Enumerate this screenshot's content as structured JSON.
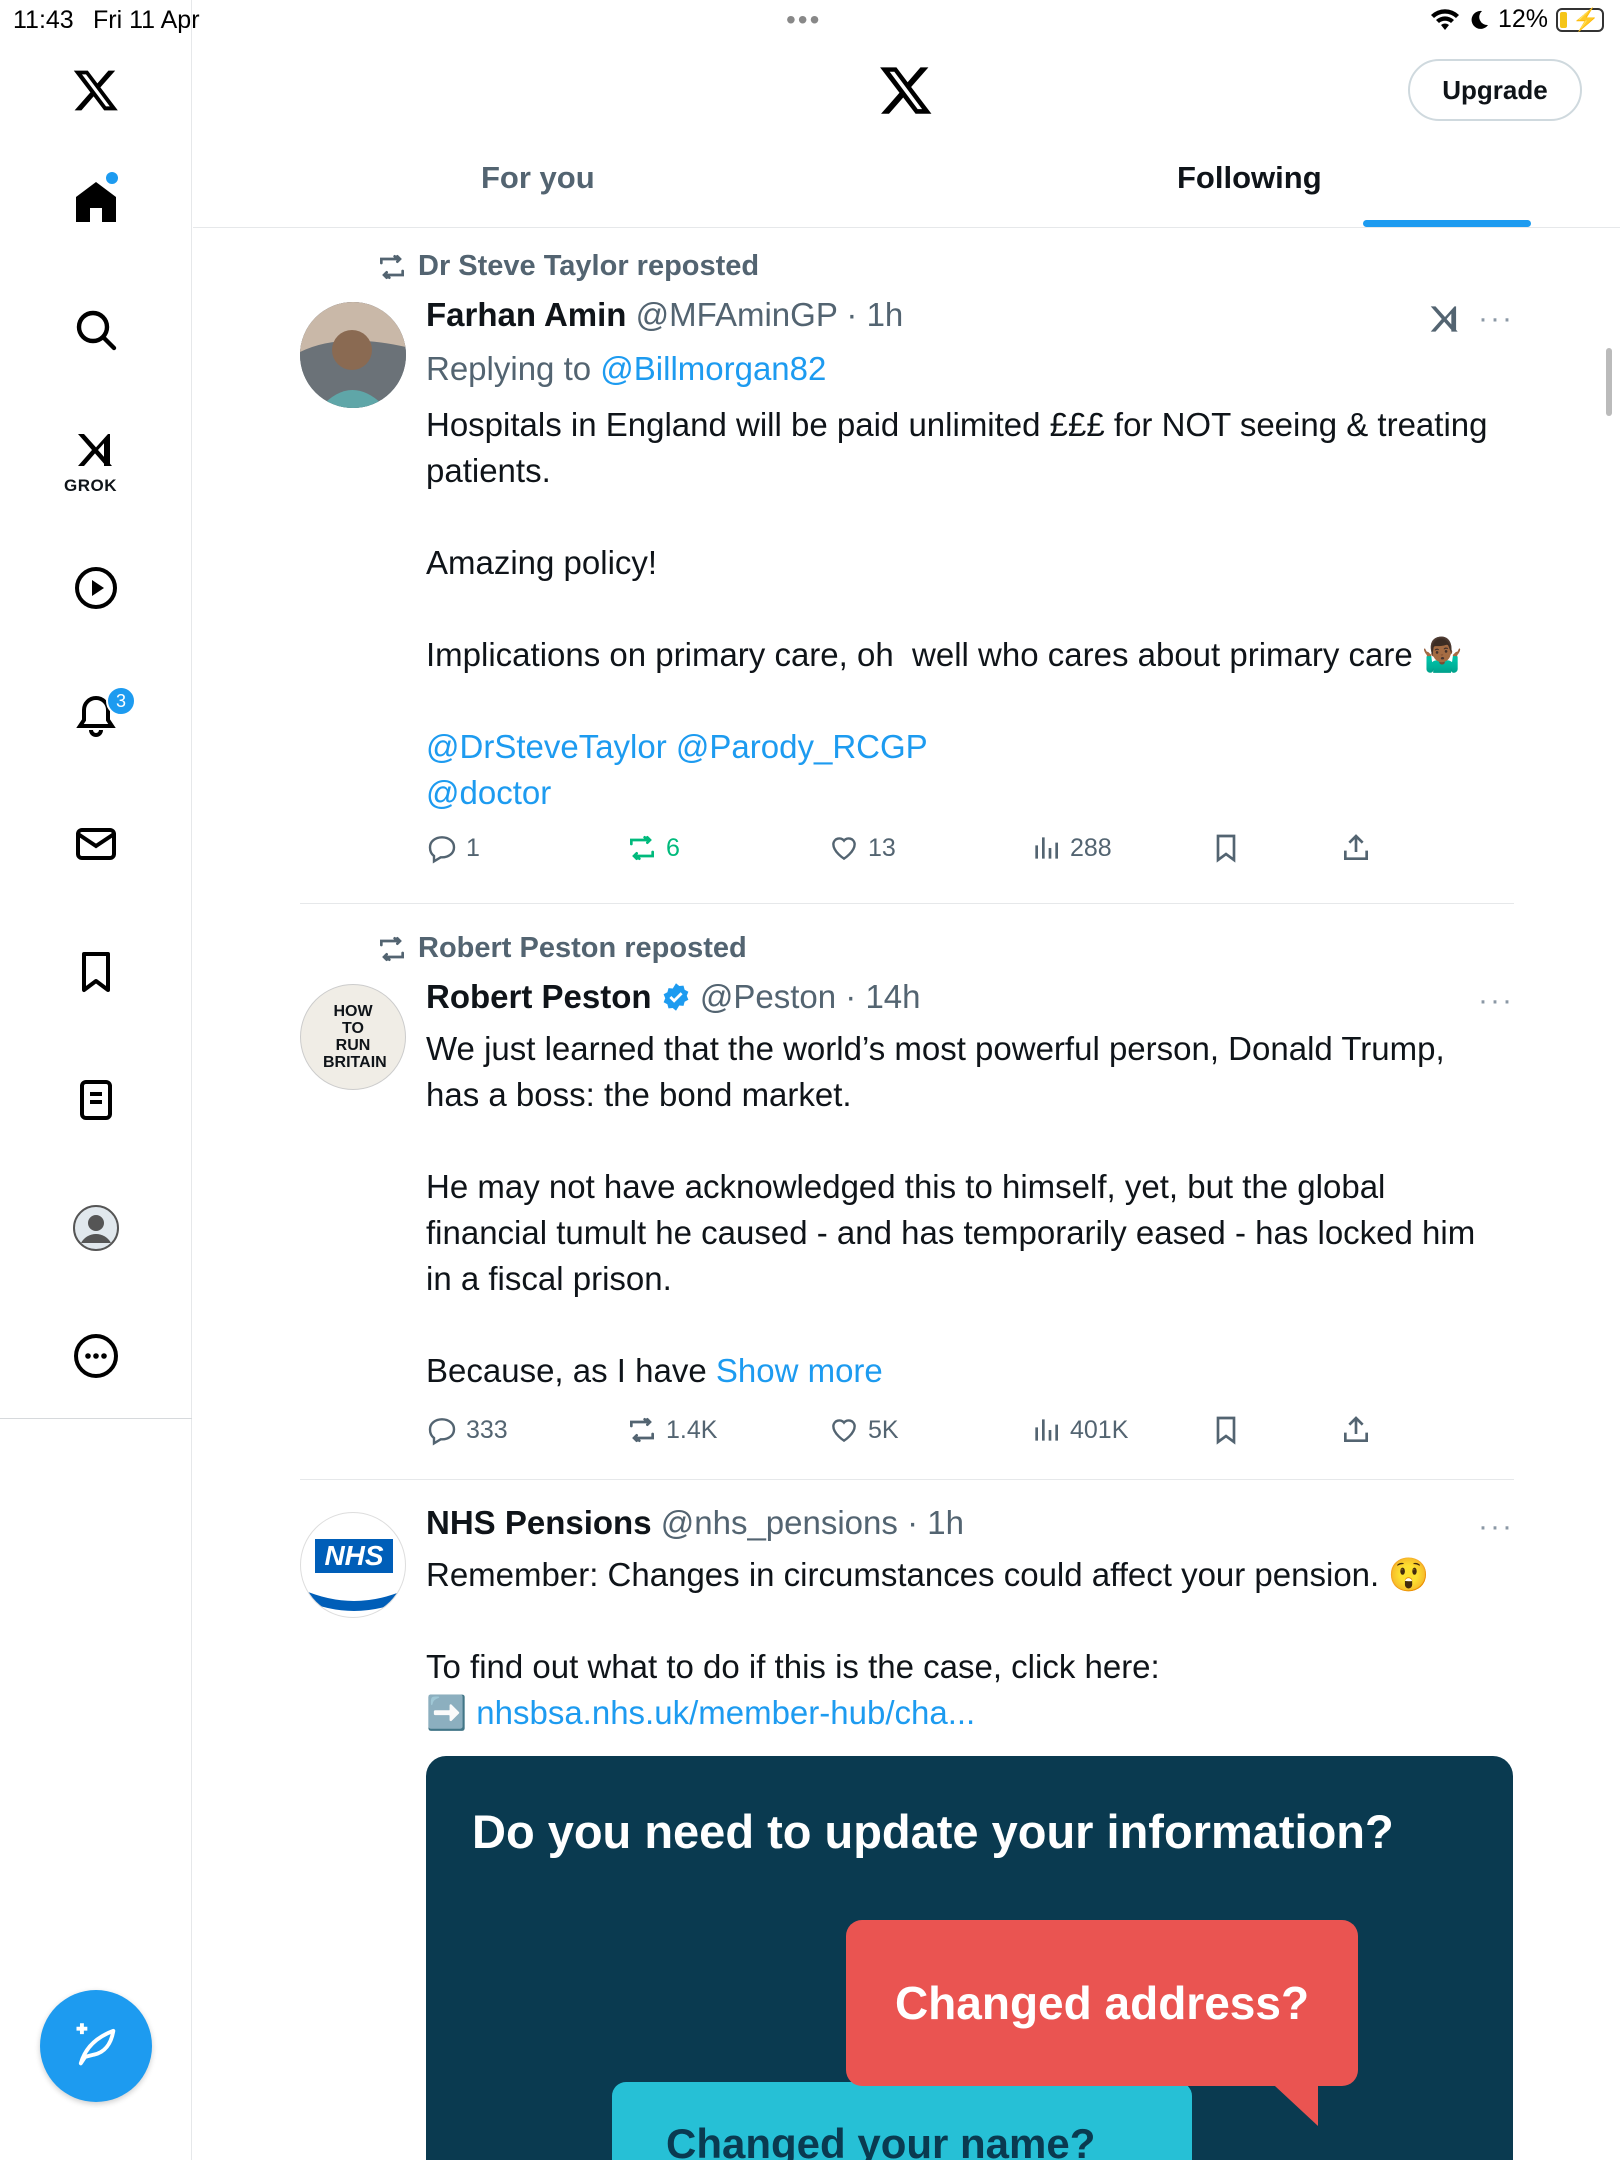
{
  "status_bar": {
    "time": "11:43",
    "date": "Fri 11 Apr",
    "battery": "12%"
  },
  "sidebar": {
    "grok_label": "GROK",
    "notifications_badge": "3"
  },
  "header": {
    "upgrade_label": "Upgrade",
    "tabs": [
      {
        "label": "For you"
      },
      {
        "label": "Following"
      }
    ]
  },
  "posts": [
    {
      "reposted_by": "Dr Steve Taylor reposted",
      "name": "Farhan Amin",
      "handle": "@MFAminGP",
      "time": "· 1h",
      "reply_prefix": "Replying to ",
      "reply_to": "@Billmorgan82",
      "text": "Hospitals in England will be paid unlimited £££ for NOT seeing & treating patients.\n\nAmazing policy!\n\nImplications on primary care, oh  well who cares about primary care 🤷🏾‍♂️\n",
      "mentions_line1": "@DrSteveTaylor @Parody_RCGP",
      "mentions_line2": "@doctor",
      "replies": "1",
      "reposts": "6",
      "likes": "13",
      "views": "288"
    },
    {
      "reposted_by": "Robert Peston reposted",
      "name": "Robert Peston",
      "handle": "@Peston",
      "time": "· 14h",
      "avatar_text": "HOW TO RUN BRITAIN",
      "text": "We just learned that the world’s most powerful person, Donald Trump, has a boss: the bond market.\n\nHe may not have acknowledged this to himself, yet, but the global financial tumult he caused - and has temporarily eased - has locked him in a fiscal prison.\n\nBecause, as I have ",
      "show_more": "Show more",
      "replies": "333",
      "reposts": "1.4K",
      "likes": "5K",
      "views": "401K"
    },
    {
      "name": "NHS Pensions",
      "handle": "@nhs_pensions",
      "time": "· 1h",
      "avatar_text": "NHS",
      "text": "Remember: Changes in circumstances could affect your pension. 😲\n\nTo find out what to do if this is the case, click here:\n",
      "link_prefix": "➡️ ",
      "link": "nhsbsa.nhs.uk/member-hub/cha...",
      "card": {
        "title": "Do you need to update your information?",
        "bubble1": "Changed address?",
        "bubble2": "Changed your name?"
      }
    }
  ],
  "colors": {
    "accent": "#1d9bf0",
    "repost_green": "#00ba7c",
    "card_bg": "#0a3a50",
    "bubble_red": "#ea5451",
    "bubble_teal": "#26c0d6"
  }
}
